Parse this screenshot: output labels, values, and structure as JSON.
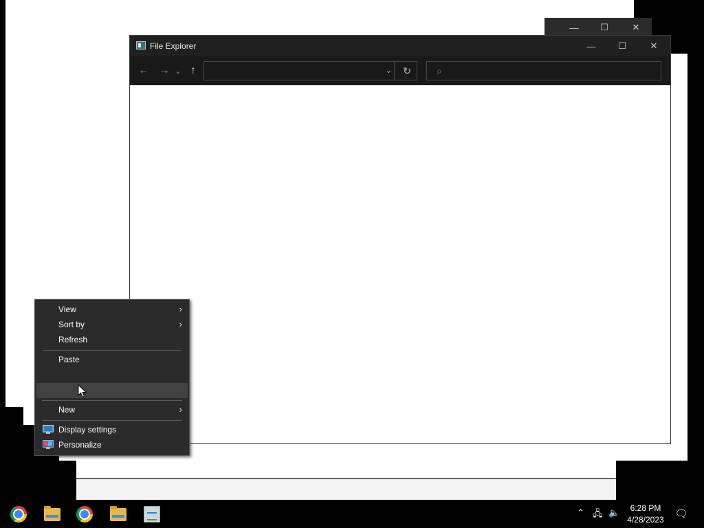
{
  "explorer": {
    "title": "File Explorer",
    "nav": {
      "back": "←",
      "forward": "→",
      "recent": "⌄",
      "up": "↑"
    },
    "address": {
      "value": "",
      "dropdown": "⌄",
      "refresh": "↻"
    },
    "search": {
      "placeholder": "",
      "icon": "⌕"
    },
    "controls": {
      "minimize": "—",
      "maximize": "☐",
      "close": "✕"
    }
  },
  "background_window": {
    "controls": {
      "minimize": "—",
      "maximize": "☐",
      "close": "✕"
    }
  },
  "context_menu": {
    "items": [
      {
        "label": "View",
        "has_submenu": true
      },
      {
        "label": "Sort by",
        "has_submenu": true
      },
      {
        "label": "Refresh",
        "has_submenu": false
      },
      {
        "label": "Paste",
        "has_submenu": false
      },
      {
        "label": "",
        "has_submenu": false,
        "highlighted": true
      },
      {
        "label": "New",
        "has_submenu": true
      },
      {
        "label": "Display settings",
        "icon": "display-icon"
      },
      {
        "label": "Personalize",
        "icon": "personalize-icon"
      }
    ],
    "arrow_glyph": "›"
  },
  "taskbar": {
    "apps": [
      {
        "name": "Google Chrome",
        "icon": "chrome-icon"
      },
      {
        "name": "File Explorer",
        "icon": "folder-icon"
      },
      {
        "name": "Google Chrome",
        "icon": "chrome-icon"
      },
      {
        "name": "File Explorer",
        "icon": "folder-icon"
      },
      {
        "name": "Control Panel",
        "icon": "control-panel-icon"
      }
    ],
    "tray": {
      "chevron": "⌃",
      "network": "🖧",
      "volume": "🔈"
    },
    "time": "6:28 PM",
    "date": "4/28/2023",
    "notifications": "🗨"
  },
  "colors": {
    "titlebar": "#202020",
    "toolbar": "#191919",
    "menu": "#2b2b2b",
    "menu_hover": "#414141",
    "taskbar": "#000000"
  }
}
